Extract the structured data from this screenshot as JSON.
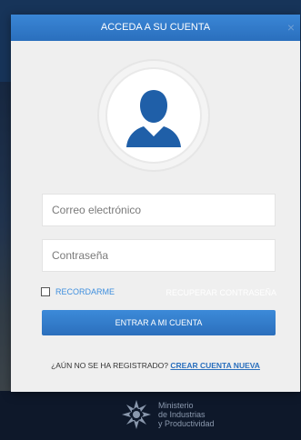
{
  "modal": {
    "title": "ACCEDA A SU CUENTA",
    "close_glyph": "×"
  },
  "form": {
    "email_placeholder": "Correo electrónico",
    "password_placeholder": "Contraseña",
    "remember_label": "RECORDARME",
    "recover_label": "RECUPERAR CONTRASEÑA",
    "submit_label": "ENTRAR A MI CUENTA",
    "register_prompt": "¿AÚN NO SE HA REGISTRADO?",
    "register_link": "CREAR CUENTA NUEVA"
  },
  "footer": {
    "line1": "Ministerio",
    "line2": "de Industrias",
    "line3": "y Productividad"
  },
  "colors": {
    "accent": "#2a6fbd",
    "header_blue": "#3a86d6",
    "avatar_blue": "#1f5fa8"
  }
}
